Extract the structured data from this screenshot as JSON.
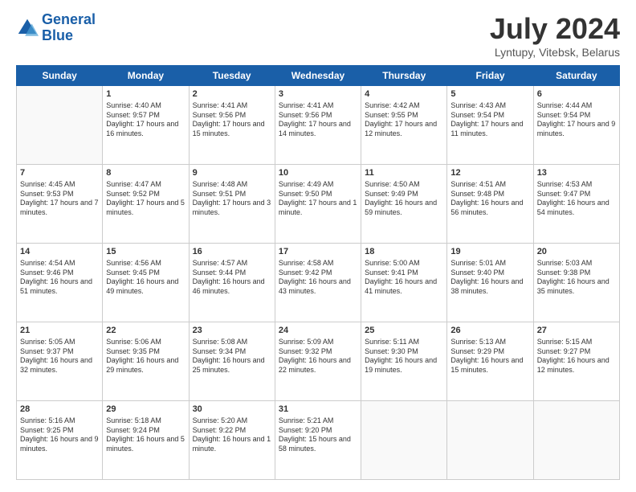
{
  "header": {
    "logo_line1": "General",
    "logo_line2": "Blue",
    "month_title": "July 2024",
    "location": "Lyntupy, Vitebsk, Belarus"
  },
  "days_of_week": [
    "Sunday",
    "Monday",
    "Tuesday",
    "Wednesday",
    "Thursday",
    "Friday",
    "Saturday"
  ],
  "weeks": [
    [
      {
        "num": "",
        "sunrise": "",
        "sunset": "",
        "daylight": ""
      },
      {
        "num": "1",
        "sunrise": "Sunrise: 4:40 AM",
        "sunset": "Sunset: 9:57 PM",
        "daylight": "Daylight: 17 hours and 16 minutes."
      },
      {
        "num": "2",
        "sunrise": "Sunrise: 4:41 AM",
        "sunset": "Sunset: 9:56 PM",
        "daylight": "Daylight: 17 hours and 15 minutes."
      },
      {
        "num": "3",
        "sunrise": "Sunrise: 4:41 AM",
        "sunset": "Sunset: 9:56 PM",
        "daylight": "Daylight: 17 hours and 14 minutes."
      },
      {
        "num": "4",
        "sunrise": "Sunrise: 4:42 AM",
        "sunset": "Sunset: 9:55 PM",
        "daylight": "Daylight: 17 hours and 12 minutes."
      },
      {
        "num": "5",
        "sunrise": "Sunrise: 4:43 AM",
        "sunset": "Sunset: 9:54 PM",
        "daylight": "Daylight: 17 hours and 11 minutes."
      },
      {
        "num": "6",
        "sunrise": "Sunrise: 4:44 AM",
        "sunset": "Sunset: 9:54 PM",
        "daylight": "Daylight: 17 hours and 9 minutes."
      }
    ],
    [
      {
        "num": "7",
        "sunrise": "Sunrise: 4:45 AM",
        "sunset": "Sunset: 9:53 PM",
        "daylight": "Daylight: 17 hours and 7 minutes."
      },
      {
        "num": "8",
        "sunrise": "Sunrise: 4:47 AM",
        "sunset": "Sunset: 9:52 PM",
        "daylight": "Daylight: 17 hours and 5 minutes."
      },
      {
        "num": "9",
        "sunrise": "Sunrise: 4:48 AM",
        "sunset": "Sunset: 9:51 PM",
        "daylight": "Daylight: 17 hours and 3 minutes."
      },
      {
        "num": "10",
        "sunrise": "Sunrise: 4:49 AM",
        "sunset": "Sunset: 9:50 PM",
        "daylight": "Daylight: 17 hours and 1 minute."
      },
      {
        "num": "11",
        "sunrise": "Sunrise: 4:50 AM",
        "sunset": "Sunset: 9:49 PM",
        "daylight": "Daylight: 16 hours and 59 minutes."
      },
      {
        "num": "12",
        "sunrise": "Sunrise: 4:51 AM",
        "sunset": "Sunset: 9:48 PM",
        "daylight": "Daylight: 16 hours and 56 minutes."
      },
      {
        "num": "13",
        "sunrise": "Sunrise: 4:53 AM",
        "sunset": "Sunset: 9:47 PM",
        "daylight": "Daylight: 16 hours and 54 minutes."
      }
    ],
    [
      {
        "num": "14",
        "sunrise": "Sunrise: 4:54 AM",
        "sunset": "Sunset: 9:46 PM",
        "daylight": "Daylight: 16 hours and 51 minutes."
      },
      {
        "num": "15",
        "sunrise": "Sunrise: 4:56 AM",
        "sunset": "Sunset: 9:45 PM",
        "daylight": "Daylight: 16 hours and 49 minutes."
      },
      {
        "num": "16",
        "sunrise": "Sunrise: 4:57 AM",
        "sunset": "Sunset: 9:44 PM",
        "daylight": "Daylight: 16 hours and 46 minutes."
      },
      {
        "num": "17",
        "sunrise": "Sunrise: 4:58 AM",
        "sunset": "Sunset: 9:42 PM",
        "daylight": "Daylight: 16 hours and 43 minutes."
      },
      {
        "num": "18",
        "sunrise": "Sunrise: 5:00 AM",
        "sunset": "Sunset: 9:41 PM",
        "daylight": "Daylight: 16 hours and 41 minutes."
      },
      {
        "num": "19",
        "sunrise": "Sunrise: 5:01 AM",
        "sunset": "Sunset: 9:40 PM",
        "daylight": "Daylight: 16 hours and 38 minutes."
      },
      {
        "num": "20",
        "sunrise": "Sunrise: 5:03 AM",
        "sunset": "Sunset: 9:38 PM",
        "daylight": "Daylight: 16 hours and 35 minutes."
      }
    ],
    [
      {
        "num": "21",
        "sunrise": "Sunrise: 5:05 AM",
        "sunset": "Sunset: 9:37 PM",
        "daylight": "Daylight: 16 hours and 32 minutes."
      },
      {
        "num": "22",
        "sunrise": "Sunrise: 5:06 AM",
        "sunset": "Sunset: 9:35 PM",
        "daylight": "Daylight: 16 hours and 29 minutes."
      },
      {
        "num": "23",
        "sunrise": "Sunrise: 5:08 AM",
        "sunset": "Sunset: 9:34 PM",
        "daylight": "Daylight: 16 hours and 25 minutes."
      },
      {
        "num": "24",
        "sunrise": "Sunrise: 5:09 AM",
        "sunset": "Sunset: 9:32 PM",
        "daylight": "Daylight: 16 hours and 22 minutes."
      },
      {
        "num": "25",
        "sunrise": "Sunrise: 5:11 AM",
        "sunset": "Sunset: 9:30 PM",
        "daylight": "Daylight: 16 hours and 19 minutes."
      },
      {
        "num": "26",
        "sunrise": "Sunrise: 5:13 AM",
        "sunset": "Sunset: 9:29 PM",
        "daylight": "Daylight: 16 hours and 15 minutes."
      },
      {
        "num": "27",
        "sunrise": "Sunrise: 5:15 AM",
        "sunset": "Sunset: 9:27 PM",
        "daylight": "Daylight: 16 hours and 12 minutes."
      }
    ],
    [
      {
        "num": "28",
        "sunrise": "Sunrise: 5:16 AM",
        "sunset": "Sunset: 9:25 PM",
        "daylight": "Daylight: 16 hours and 9 minutes."
      },
      {
        "num": "29",
        "sunrise": "Sunrise: 5:18 AM",
        "sunset": "Sunset: 9:24 PM",
        "daylight": "Daylight: 16 hours and 5 minutes."
      },
      {
        "num": "30",
        "sunrise": "Sunrise: 5:20 AM",
        "sunset": "Sunset: 9:22 PM",
        "daylight": "Daylight: 16 hours and 1 minute."
      },
      {
        "num": "31",
        "sunrise": "Sunrise: 5:21 AM",
        "sunset": "Sunset: 9:20 PM",
        "daylight": "Daylight: 15 hours and 58 minutes."
      },
      {
        "num": "",
        "sunrise": "",
        "sunset": "",
        "daylight": ""
      },
      {
        "num": "",
        "sunrise": "",
        "sunset": "",
        "daylight": ""
      },
      {
        "num": "",
        "sunrise": "",
        "sunset": "",
        "daylight": ""
      }
    ]
  ]
}
